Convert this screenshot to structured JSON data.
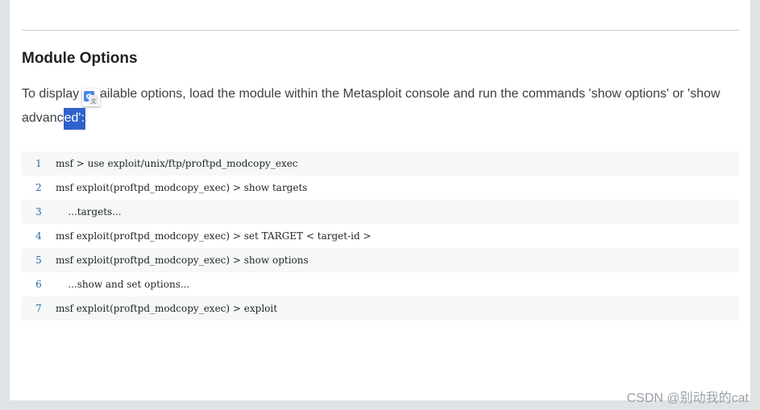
{
  "section": {
    "heading": "Module Options",
    "paragraph_before_icon": "To display t",
    "paragraph_middle": "available options, load the module within the Metasploit console and run the commands 'show options' or 'show advanc",
    "paragraph_selected": "ed':"
  },
  "code": {
    "lines": [
      {
        "num": "1",
        "text": "msf > use exploit/unix/ftp/proftpd_modcopy_exec"
      },
      {
        "num": "2",
        "text": "msf exploit(proftpd_modcopy_exec) > show targets"
      },
      {
        "num": "3",
        "text": "    ...targets..."
      },
      {
        "num": "4",
        "text": "msf exploit(proftpd_modcopy_exec) > set TARGET < target-id >"
      },
      {
        "num": "5",
        "text": "msf exploit(proftpd_modcopy_exec) > show options"
      },
      {
        "num": "6",
        "text": "    ...show and set options..."
      },
      {
        "num": "7",
        "text": "msf exploit(proftpd_modcopy_exec) > exploit"
      }
    ]
  },
  "watermark": "CSDN @别动我的cat",
  "colors": {
    "selection": "#2f62cc",
    "line_number": "#2a6aa5",
    "code_stripe": "#f6f8f8",
    "page_bg": "#dfe3e6"
  },
  "icons": {
    "translate": "google-translate-icon"
  }
}
